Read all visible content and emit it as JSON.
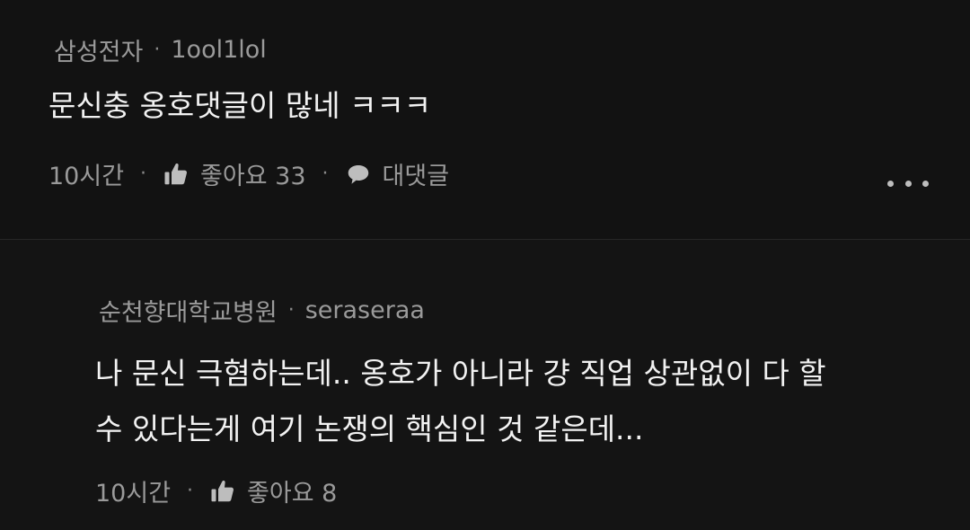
{
  "comments": [
    {
      "company": "삼성전자",
      "author": "1ool1lol",
      "text_lines": [
        "문신충 옹호댓글이 많네 ㅋㅋㅋ"
      ],
      "time": "10시간",
      "like_label": "좋아요 33",
      "reply_label": "대댓글"
    },
    {
      "company": "순천향대학교병원",
      "author": "seraseraa",
      "text_lines": [
        "나 문신 극혐하는데.. 옹호가 아니라 걍 직업 상관없이 다 할",
        "수 있다는게 여기 논쟁의 핵심인 것 같은데..."
      ],
      "time": "10시간",
      "like_label": "좋아요 8"
    }
  ],
  "separator": "·",
  "icons": {
    "like": "thumbs-up-icon",
    "reply": "speech-bubble-icon",
    "more": "more-dots-icon"
  },
  "colors": {
    "background": "#121212",
    "text_primary": "#f2f2f2",
    "text_secondary": "#9a9a9a"
  }
}
